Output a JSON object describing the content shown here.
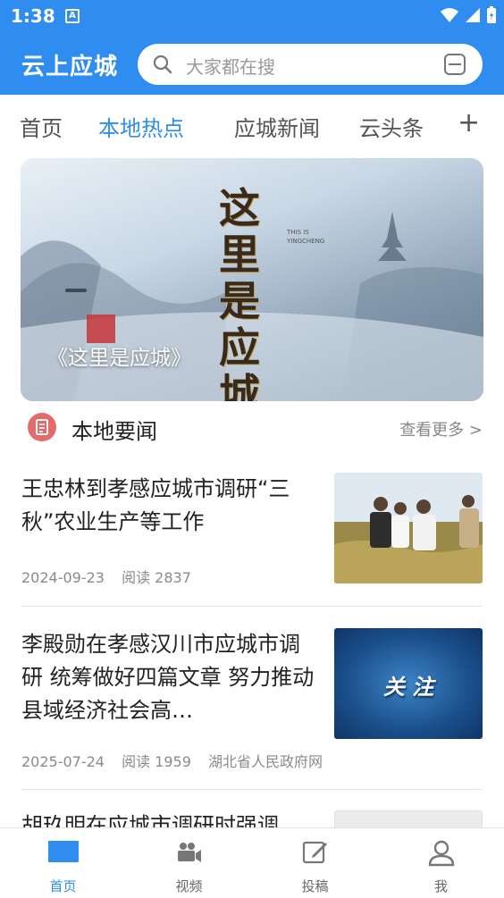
{
  "status_bar": {
    "time": "1:38",
    "app_badge": "A"
  },
  "header": {
    "app_title": "云上应城",
    "search_placeholder": "大家都在搜"
  },
  "tabs": [
    {
      "label": "首页",
      "active": false
    },
    {
      "label": "本地热点",
      "active": true
    },
    {
      "label": "应城新闻",
      "active": false
    },
    {
      "label": "云头条",
      "active": false
    }
  ],
  "tab_add": "+",
  "banner": {
    "caption": "《这里是应城》",
    "artwork_text": "这里是应城",
    "artwork_subtitle": "THIS IS YINGCHENG"
  },
  "local_news": {
    "title": "本地要闻",
    "more": "查看更多 >",
    "items": [
      {
        "title": "王忠林到孝感应城市调研“三秋”农业生产等工作",
        "date": "2024-09-23",
        "reads": "阅读 2837",
        "source": ""
      },
      {
        "title": "李殿勋在孝感汉川市应城市调研  统筹做好四篇文章  努力推动县域经济社会高…",
        "date": "2025-07-24",
        "reads": "阅读 1959",
        "source": "湖北省人民政府网"
      },
      {
        "title": "胡玖明在应城市调研时强调",
        "date": "",
        "reads": "",
        "source": ""
      }
    ],
    "thumb2_text": "关 注"
  },
  "bottom_nav": [
    {
      "label": "首页",
      "icon": "home-icon",
      "active": true
    },
    {
      "label": "视频",
      "icon": "video-icon",
      "active": false
    },
    {
      "label": "投稿",
      "icon": "edit-icon",
      "active": false
    },
    {
      "label": "我",
      "icon": "user-icon",
      "active": false
    }
  ],
  "colors": {
    "brand": "#2f8df0",
    "text": "#222222",
    "muted": "#8a8a8a"
  }
}
